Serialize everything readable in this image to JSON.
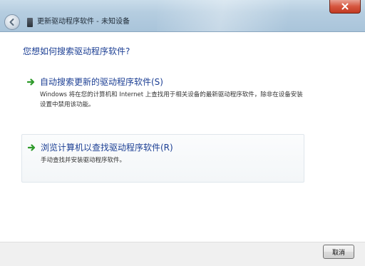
{
  "window": {
    "title": "更新驱动程序软件 - 未知设备",
    "close_icon": "close-icon",
    "back_icon": "back-arrow-icon",
    "device_icon": "device-icon",
    "accent_close": "#d6563f"
  },
  "main": {
    "question": "您想如何搜索驱动程序软件?",
    "options": [
      {
        "title": "自动搜索更新的驱动程序软件(S)",
        "description": "Windows 将在您的计算机和 Internet 上查找用于相关设备的最新驱动程序软件，除非在设备安装设置中禁用该功能。",
        "icon": "green-arrow-icon"
      },
      {
        "title": "浏览计算机以查找驱动程序软件(R)",
        "description": "手动查找并安装驱动程序软件。",
        "icon": "green-arrow-icon"
      }
    ],
    "link_color": "#1c3f94",
    "arrow_color": "#2e9a2a"
  },
  "footer": {
    "cancel_label": "取消"
  }
}
